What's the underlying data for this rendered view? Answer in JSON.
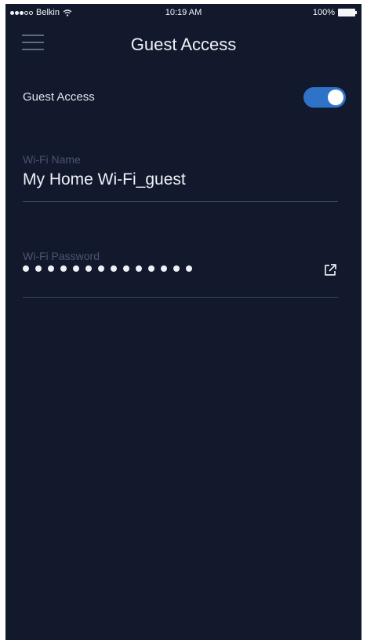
{
  "status_bar": {
    "carrier": "Belkin",
    "time": "10:19 AM",
    "battery": "100%",
    "signal_bars_filled": 3,
    "signal_bars_total": 5
  },
  "nav": {
    "title": "Guest Access",
    "menu_icon": "hamburger-menu-icon"
  },
  "guest_access": {
    "label": "Guest Access",
    "enabled": true
  },
  "wifi_name": {
    "label": "Wi-Fi Name",
    "value": "My Home Wi-Fi_guest"
  },
  "wifi_password": {
    "label": "Wi-Fi Password",
    "masked_length": 14,
    "share_icon": "share-icon"
  },
  "colors": {
    "background": "#13192d",
    "accent": "#2f73c9",
    "text": "#eef1f6",
    "muted": "#4a5470"
  }
}
